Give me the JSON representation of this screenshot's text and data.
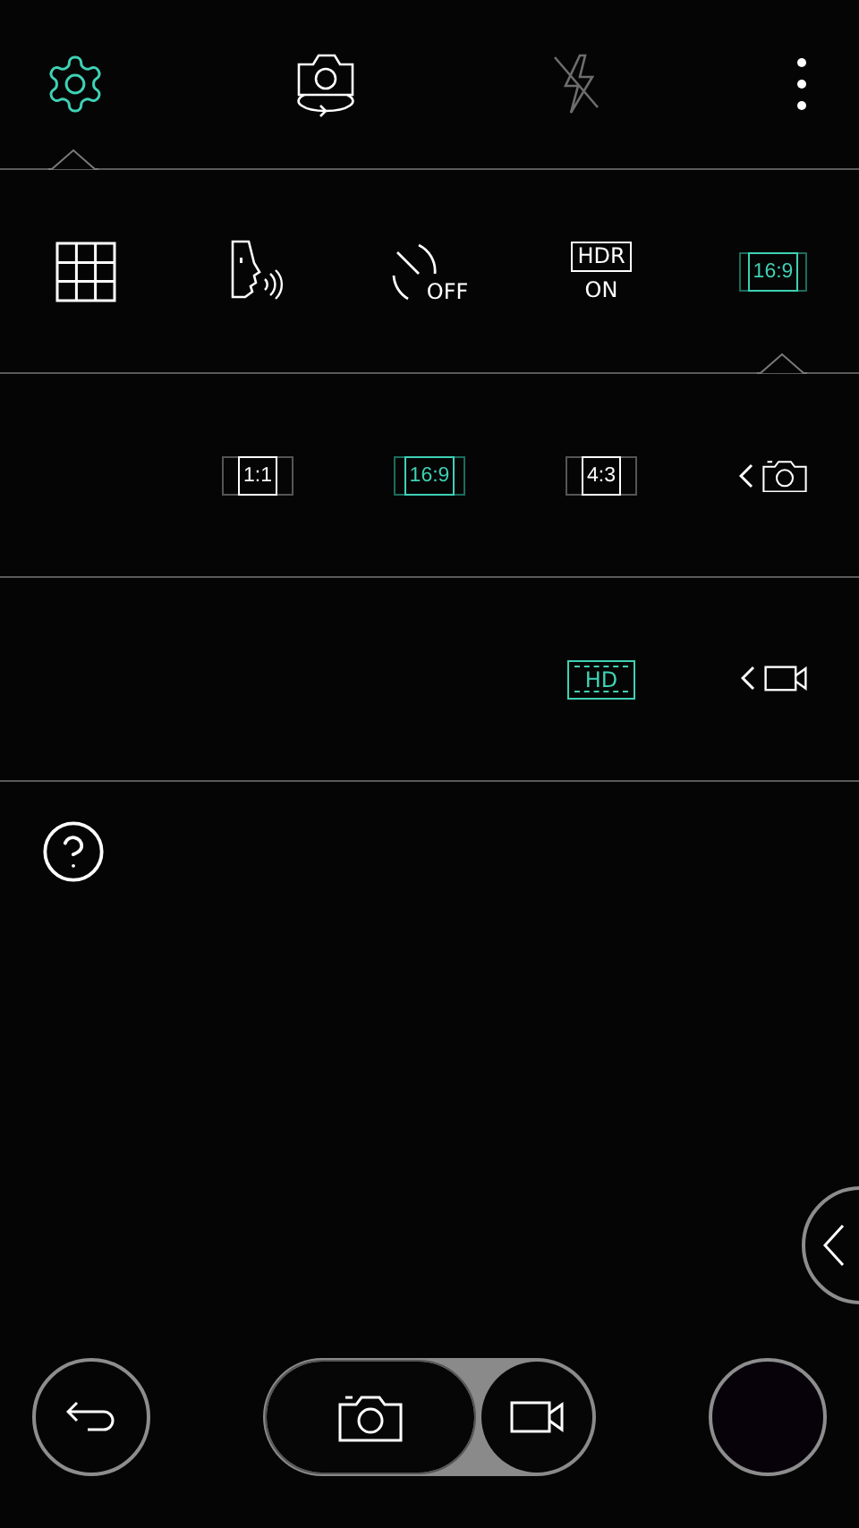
{
  "top_bar": {
    "items": [
      {
        "kind": "settings",
        "selected": true
      },
      {
        "kind": "switch_camera",
        "selected": false
      },
      {
        "kind": "flash",
        "selected": false,
        "disabled": true
      },
      {
        "kind": "more",
        "selected": false
      }
    ]
  },
  "settings_row": {
    "items": [
      {
        "kind": "grid",
        "selected": false
      },
      {
        "kind": "voice",
        "selected": false
      },
      {
        "kind": "timer",
        "label": "OFF",
        "selected": false
      },
      {
        "kind": "hdr",
        "label": "HDR",
        "status": "ON",
        "selected": false
      },
      {
        "kind": "ratio",
        "label": "16:9",
        "selected": true
      }
    ]
  },
  "photo_size": {
    "kind": "photo",
    "options": [
      {
        "label": "1:1",
        "selected": false
      },
      {
        "label": "16:9",
        "selected": true
      },
      {
        "label": "4:3",
        "selected": false
      }
    ]
  },
  "video_size": {
    "kind": "video",
    "options": [
      {
        "label": "HD",
        "selected": true
      }
    ]
  },
  "mode_switch": {
    "options": [
      {
        "kind": "photo",
        "selected": true
      },
      {
        "kind": "video",
        "selected": false
      }
    ]
  }
}
